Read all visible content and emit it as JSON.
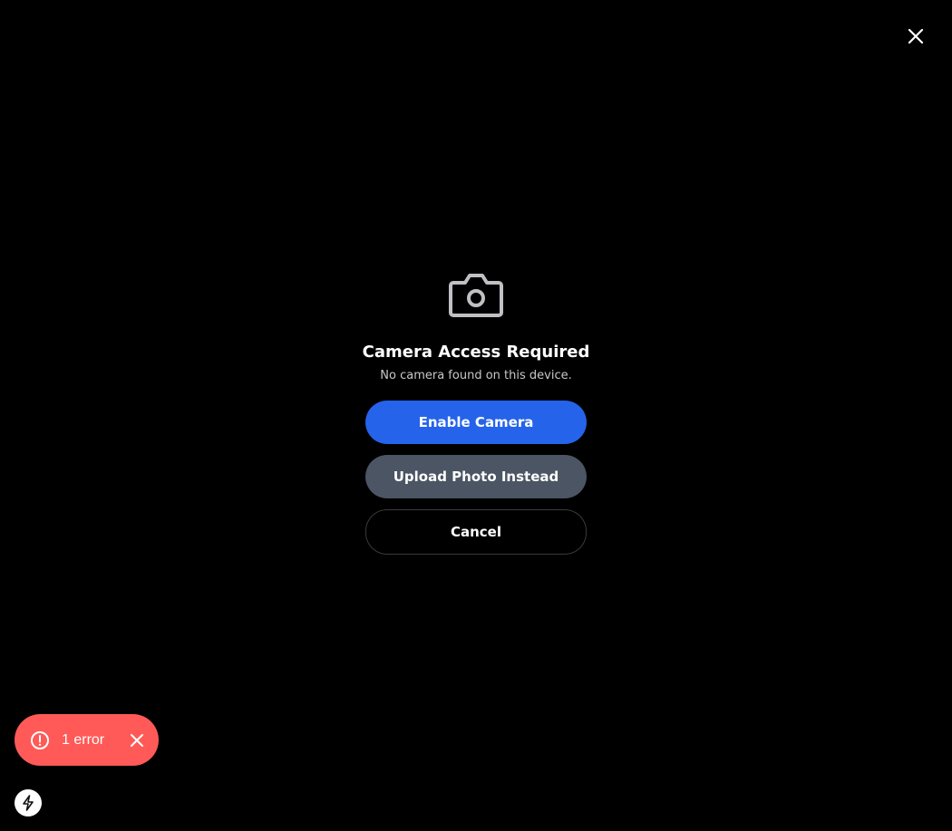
{
  "dialog": {
    "title": "Camera Access Required",
    "message": "No camera found on this device.",
    "icon": "camera-icon",
    "buttons": {
      "enable_camera": "Enable Camera",
      "upload_photo": "Upload Photo Instead",
      "cancel": "Cancel"
    }
  },
  "overlay": {
    "close_icon": "close-icon"
  },
  "dev_indicator": {
    "error_label": "1 error",
    "alert_icon": "alert-circle-icon",
    "dismiss_icon": "close-icon",
    "badge_icon": "lightning-bolt-icon"
  },
  "colors": {
    "background": "#000000",
    "primary_button": "#2563eb",
    "secondary_button": "#4b5563",
    "error_pill": "#ff5a57",
    "icon_gray": "#c0c0c4"
  }
}
